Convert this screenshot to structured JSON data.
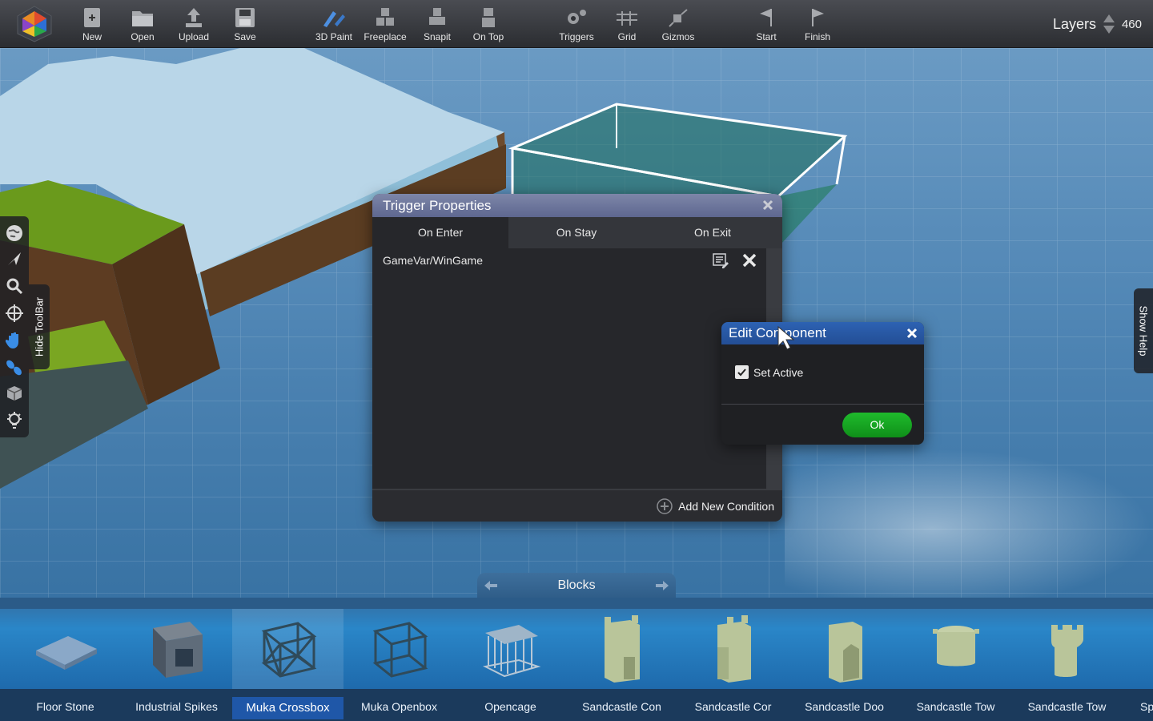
{
  "toolbar": {
    "buttons": [
      {
        "label": "New",
        "icon": "new-file-icon"
      },
      {
        "label": "Open",
        "icon": "folder-open-icon"
      },
      {
        "label": "Upload",
        "icon": "upload-icon"
      },
      {
        "label": "Save",
        "icon": "save-disk-icon"
      },
      {
        "label": "3D Paint",
        "icon": "paint-icon"
      },
      {
        "label": "Freeplace",
        "icon": "cubes-icon"
      },
      {
        "label": "Snapit",
        "icon": "snap-cubes-icon"
      },
      {
        "label": "On Top",
        "icon": "stack-icon"
      },
      {
        "label": "Triggers",
        "icon": "gears-icon"
      },
      {
        "label": "Grid",
        "icon": "grid-icon"
      },
      {
        "label": "Gizmos",
        "icon": "gizmo-icon"
      },
      {
        "label": "Start",
        "icon": "start-flag-icon"
      },
      {
        "label": "Finish",
        "icon": "finish-flag-icon"
      }
    ],
    "layers_label": "Layers",
    "layers_value": "460"
  },
  "left_toolbar": {
    "hide_label": "Hide ToolBar"
  },
  "show_help_label": "Show Help",
  "trigger_dialog": {
    "title": "Trigger Properties",
    "tabs": [
      "On Enter",
      "On Stay",
      "On Exit"
    ],
    "active_tab": 0,
    "condition": "GameVar/WinGame",
    "add_condition_label": "Add New Condition"
  },
  "edit_component": {
    "title": "Edit Component",
    "checkbox_label": "Set Active",
    "checked": true,
    "ok_label": "Ok"
  },
  "blocks": {
    "category": "Blocks",
    "items": [
      "Floor Stone",
      "Industrial Spikes",
      "Muka Crossbox",
      "Muka Openbox",
      "Opencage",
      "Sandcastle Con",
      "Sandcastle Cor",
      "Sandcastle Doo",
      "Sandcastle Tow",
      "Sandcastle Tow",
      "Sp"
    ],
    "selected_index": 2
  }
}
